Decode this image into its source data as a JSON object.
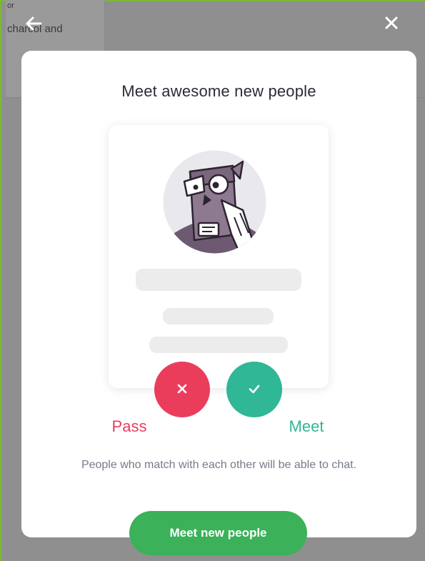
{
  "background": {
    "top_text": "or",
    "text": "charcol and"
  },
  "header": {
    "back_icon": "arrow-left-icon",
    "close_icon": "close-icon"
  },
  "modal": {
    "title": "Meet awesome new people",
    "avatar_icon": "owl-avatar-icon",
    "pass_icon": "x-icon",
    "meet_icon": "check-icon",
    "pass_label": "Pass",
    "meet_label": "Meet",
    "description": "People who match with each other will be able to chat.",
    "cta_label": "Meet new people"
  },
  "colors": {
    "pass": "#ea3d5c",
    "meet": "#2fb796",
    "cta": "#3bb15a",
    "overlay": "#8f8f8f"
  }
}
